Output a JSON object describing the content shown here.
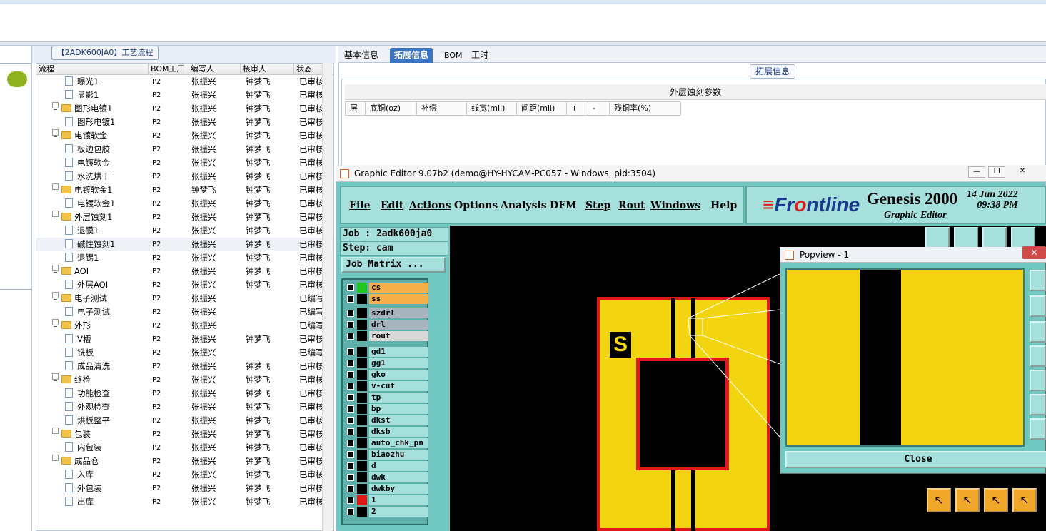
{
  "left_panel": {
    "tab_title": "【2ADK600JA0】工艺流程",
    "columns": [
      "流程",
      "BOM工厂",
      "编写人",
      "核审人",
      "状态"
    ],
    "rows": [
      {
        "indent": 2,
        "type": "doc",
        "name": "曝光1",
        "bom": "P2",
        "writer": "张振兴",
        "reviewer": "钟梦飞",
        "status": "已审核"
      },
      {
        "indent": 2,
        "type": "doc",
        "name": "显影1",
        "bom": "P2",
        "writer": "张振兴",
        "reviewer": "钟梦飞",
        "status": "已审核"
      },
      {
        "indent": 1,
        "type": "folder",
        "name": "图形电镀1",
        "bom": "P2",
        "writer": "张振兴",
        "reviewer": "钟梦飞",
        "status": "已审核"
      },
      {
        "indent": 2,
        "type": "doc",
        "name": "图形电镀1",
        "bom": "P2",
        "writer": "张振兴",
        "reviewer": "钟梦飞",
        "status": "已审核"
      },
      {
        "indent": 1,
        "type": "folder",
        "name": "电镀软金",
        "bom": "P2",
        "writer": "张振兴",
        "reviewer": "钟梦飞",
        "status": "已审核"
      },
      {
        "indent": 2,
        "type": "doc",
        "name": "板边包胶",
        "bom": "P2",
        "writer": "张振兴",
        "reviewer": "钟梦飞",
        "status": "已审核"
      },
      {
        "indent": 2,
        "type": "doc",
        "name": "电镀软金",
        "bom": "P2",
        "writer": "张振兴",
        "reviewer": "钟梦飞",
        "status": "已审核"
      },
      {
        "indent": 2,
        "type": "doc",
        "name": "水洗烘干",
        "bom": "P2",
        "writer": "张振兴",
        "reviewer": "钟梦飞",
        "status": "已审核"
      },
      {
        "indent": 1,
        "type": "folder",
        "name": "电镀软金1",
        "bom": "P2",
        "writer": "钟梦飞",
        "reviewer": "钟梦飞",
        "status": "已审核"
      },
      {
        "indent": 2,
        "type": "doc",
        "name": "电镀软金1",
        "bom": "P2",
        "writer": "张振兴",
        "reviewer": "钟梦飞",
        "status": "已审核"
      },
      {
        "indent": 1,
        "type": "folder",
        "name": "外层蚀刻1",
        "bom": "P2",
        "writer": "张振兴",
        "reviewer": "钟梦飞",
        "status": "已审核"
      },
      {
        "indent": 2,
        "type": "doc",
        "name": "退膜1",
        "bom": "P2",
        "writer": "张振兴",
        "reviewer": "钟梦飞",
        "status": "已审核"
      },
      {
        "indent": 2,
        "type": "doc",
        "name": "碱性蚀刻1",
        "bom": "P2",
        "writer": "张振兴",
        "reviewer": "钟梦飞",
        "status": "已审核",
        "selected": true
      },
      {
        "indent": 2,
        "type": "doc",
        "name": "退锡1",
        "bom": "P2",
        "writer": "张振兴",
        "reviewer": "钟梦飞",
        "status": "已审核"
      },
      {
        "indent": 1,
        "type": "folder",
        "name": "AOI",
        "bom": "P2",
        "writer": "张振兴",
        "reviewer": "钟梦飞",
        "status": "已审核"
      },
      {
        "indent": 2,
        "type": "doc",
        "name": "外层AOI",
        "bom": "P2",
        "writer": "张振兴",
        "reviewer": "钟梦飞",
        "status": "已审核"
      },
      {
        "indent": 1,
        "type": "folder",
        "name": "电子测试",
        "bom": "P2",
        "writer": "张振兴",
        "reviewer": "",
        "status": "已编写"
      },
      {
        "indent": 2,
        "type": "doc",
        "name": "电子测试",
        "bom": "P2",
        "writer": "张振兴",
        "reviewer": "",
        "status": "已编写"
      },
      {
        "indent": 1,
        "type": "folder",
        "name": "外形",
        "bom": "P2",
        "writer": "张振兴",
        "reviewer": "",
        "status": "已编写"
      },
      {
        "indent": 2,
        "type": "doc",
        "name": "V槽",
        "bom": "P2",
        "writer": "张振兴",
        "reviewer": "钟梦飞",
        "status": "已审核"
      },
      {
        "indent": 2,
        "type": "doc",
        "name": "铣板",
        "bom": "P2",
        "writer": "张振兴",
        "reviewer": "",
        "status": "已编写"
      },
      {
        "indent": 2,
        "type": "doc",
        "name": "成品清洗",
        "bom": "P2",
        "writer": "张振兴",
        "reviewer": "钟梦飞",
        "status": "已审核"
      },
      {
        "indent": 1,
        "type": "folder",
        "name": "终检",
        "bom": "P2",
        "writer": "张振兴",
        "reviewer": "钟梦飞",
        "status": "已审核"
      },
      {
        "indent": 2,
        "type": "doc",
        "name": "功能检查",
        "bom": "P2",
        "writer": "张振兴",
        "reviewer": "钟梦飞",
        "status": "已审核"
      },
      {
        "indent": 2,
        "type": "doc",
        "name": "外观检查",
        "bom": "P2",
        "writer": "张振兴",
        "reviewer": "钟梦飞",
        "status": "已审核"
      },
      {
        "indent": 2,
        "type": "doc",
        "name": "烘板整平",
        "bom": "P2",
        "writer": "张振兴",
        "reviewer": "钟梦飞",
        "status": "已审核"
      },
      {
        "indent": 1,
        "type": "folder",
        "name": "包装",
        "bom": "P2",
        "writer": "张振兴",
        "reviewer": "钟梦飞",
        "status": "已审核"
      },
      {
        "indent": 2,
        "type": "doc",
        "name": "内包装",
        "bom": "P2",
        "writer": "张振兴",
        "reviewer": "钟梦飞",
        "status": "已审核"
      },
      {
        "indent": 1,
        "type": "folder",
        "name": "成品仓",
        "bom": "P2",
        "writer": "张振兴",
        "reviewer": "钟梦飞",
        "status": "已审核"
      },
      {
        "indent": 2,
        "type": "doc",
        "name": "入库",
        "bom": "P2",
        "writer": "张振兴",
        "reviewer": "钟梦飞",
        "status": "已审核"
      },
      {
        "indent": 2,
        "type": "doc",
        "name": "外包装",
        "bom": "P2",
        "writer": "张振兴",
        "reviewer": "钟梦飞",
        "status": "已审核"
      },
      {
        "indent": 2,
        "type": "doc",
        "name": "出库",
        "bom": "P2",
        "writer": "张振兴",
        "reviewer": "钟梦飞",
        "status": "已审核"
      }
    ]
  },
  "right_panel": {
    "tabs": [
      "基本信息",
      "拓展信息",
      "BOM",
      "工时"
    ],
    "active_tab": "拓展信息",
    "group_label": "拓展信息",
    "table_title": "外层蚀刻参数",
    "table_columns": [
      "层",
      "底铜(oz)",
      "补偿",
      "线宽(mil)",
      "间距(mil)",
      "+",
      "-",
      "残铜率(%)"
    ]
  },
  "genesis": {
    "window_title": "Graphic Editor 9.07b2 (demo@HY-HYCAM-PC057 - Windows, pid:3504)",
    "menus": [
      "File",
      "Edit",
      "Actions",
      "Options",
      "Analysis",
      "DFM",
      "Step",
      "Rout",
      "Windows",
      "Help"
    ],
    "brand": "Frontline",
    "product": "Genesis 2000",
    "subtitle": "Graphic Editor",
    "date": "14 Jun 2022",
    "time": "09:38 PM",
    "job_line": "Job : 2adk600ja0",
    "step_line": "Step: cam",
    "job_matrix_label": "Job Matrix ...",
    "layers": [
      {
        "name": "cs",
        "color": "#f5b04a",
        "swatch": "#22c422"
      },
      {
        "name": "ss",
        "color": "#f5b04a",
        "swatch": "#000000"
      },
      {
        "name": "szdrl",
        "color": "#a7b4bd",
        "swatch": "#000000"
      },
      {
        "name": "drl",
        "color": "#a7b4bd",
        "swatch": "#000000"
      },
      {
        "name": "rout",
        "color": "#d8d8d8",
        "swatch": "#000000"
      },
      {
        "name": "gd1",
        "color": "#a6e0dc",
        "swatch": "#000000"
      },
      {
        "name": "gg1",
        "color": "#a6e0dc",
        "swatch": "#000000"
      },
      {
        "name": "gko",
        "color": "#a6e0dc",
        "swatch": "#000000"
      },
      {
        "name": "v-cut",
        "color": "#a6e0dc",
        "swatch": "#000000"
      },
      {
        "name": "tp",
        "color": "#a6e0dc",
        "swatch": "#000000"
      },
      {
        "name": "bp",
        "color": "#a6e0dc",
        "swatch": "#000000"
      },
      {
        "name": "dkst",
        "color": "#a6e0dc",
        "swatch": "#000000"
      },
      {
        "name": "dksb",
        "color": "#a6e0dc",
        "swatch": "#000000"
      },
      {
        "name": "auto_chk_pn",
        "color": "#a6e0dc",
        "swatch": "#000000"
      },
      {
        "name": "biaozhu",
        "color": "#a6e0dc",
        "swatch": "#000000"
      },
      {
        "name": "d",
        "color": "#a6e0dc",
        "swatch": "#000000"
      },
      {
        "name": "dwk",
        "color": "#a6e0dc",
        "swatch": "#000000"
      },
      {
        "name": "dwkby",
        "color": "#a6e0dc",
        "swatch": "#000000"
      },
      {
        "name": "1",
        "color": "#a6e0dc",
        "swatch": "#e01818"
      },
      {
        "name": "2",
        "color": "#a6e0dc",
        "swatch": "#000000"
      }
    ],
    "board_label": "S"
  },
  "popview": {
    "title": "Popview - 1",
    "close_label": "Close"
  }
}
